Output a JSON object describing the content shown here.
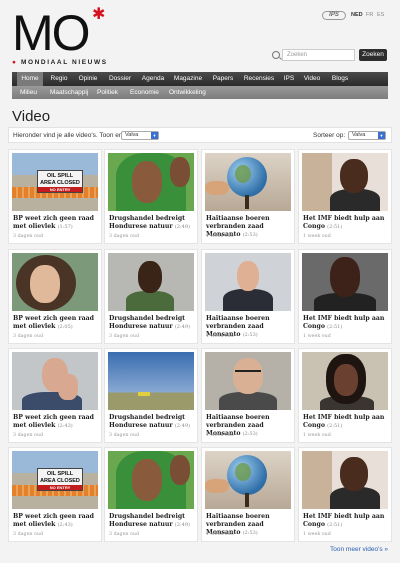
{
  "site": {
    "logo": "MO",
    "tagline": "MONDIAAL NIEUWS",
    "partner_badge": "IPS",
    "languages": [
      "NED",
      "FR",
      "ES"
    ]
  },
  "search": {
    "placeholder": "Zoeken",
    "button": "Zoeken"
  },
  "nav": {
    "primary": [
      "Home",
      "Regio",
      "Opinie",
      "Dossier",
      "Agenda",
      "Magazine",
      "Papers",
      "Recensies",
      "IPS",
      "Video",
      "Blogs"
    ],
    "active": "Home",
    "secondary": [
      "Milieu",
      "Maatschappij",
      "Politiek",
      "Economie",
      "Ontwikkeling"
    ]
  },
  "page": {
    "title": "Video",
    "filter_label": "Hieronder vind je alle video's. Toon enkel:",
    "filter_value": "Valva",
    "sort_label": "Sorteer op:",
    "sort_value": "Valva",
    "more_link": "Toon meer video's »"
  },
  "videos": [
    {
      "title": "BP weet zich geen raad met olievlek",
      "duration": "(1:57)",
      "date": "3 dagen oud",
      "thumb": "oil-spill"
    },
    {
      "title": "Drugshandel bedreigt Hondurese natuur",
      "duration": "(2:49)",
      "date": "3 dagen oud",
      "thumb": "girl-green-scarf"
    },
    {
      "title": "Haïtiaanse boeren verbranden zaad Monsanto",
      "duration": "(2:53)",
      "date": "1 week oud",
      "thumb": "globe"
    },
    {
      "title": "Het IMF biedt hulp aan Congo",
      "duration": "(2:51)",
      "date": "1 week oud",
      "thumb": "woman"
    },
    {
      "title": "BP weet zich geen raad met olievlek",
      "duration": "(2:05)",
      "date": "3 dagen oud",
      "thumb": "curly-hair"
    },
    {
      "title": "Drugshandel bedreigt Hondurese natuur",
      "duration": "(2:49)",
      "date": "3 dagen oud",
      "thumb": "man-green-shirt"
    },
    {
      "title": "Haïtiaanse boeren verbranden zaad Monsanto",
      "duration": "(2:53)",
      "date": "1 week oud",
      "thumb": "man-suit"
    },
    {
      "title": "Het IMF biedt hulp aan Congo",
      "duration": "(2:51)",
      "date": "1 week oud",
      "thumb": "man-dark"
    },
    {
      "title": "BP weet zich geen raad met olievlek",
      "duration": "(2:43)",
      "date": "3 dagen oud",
      "thumb": "man-hand-face"
    },
    {
      "title": "Drugshandel bedreigt Hondurese natuur",
      "duration": "(2:49)",
      "date": "3 dagen oud",
      "thumb": "sky"
    },
    {
      "title": "Haïtiaanse boeren verbranden zaad Monsanto",
      "duration": "(2:53)",
      "date": "1 week oud",
      "thumb": "man-glasses"
    },
    {
      "title": "Het IMF biedt hulp aan Congo",
      "duration": "(2:51)",
      "date": "1 week oud",
      "thumb": "woman-2"
    },
    {
      "title": "BP weet zich geen raad met olievlek",
      "duration": "(2:43)",
      "date": "3 dagen oud",
      "thumb": "oil-spill"
    },
    {
      "title": "Drugshandel bedreigt Hondurese natuur",
      "duration": "(2:49)",
      "date": "3 dagen oud",
      "thumb": "girl-green-scarf"
    },
    {
      "title": "Haïtiaanse boeren verbranden zaad Monsanto",
      "duration": "(2:53)",
      "date": "1 week oud",
      "thumb": "globe"
    },
    {
      "title": "Het IMF biedt hulp aan Congo",
      "duration": "(2:51)",
      "date": "1 week oud",
      "thumb": "woman"
    }
  ],
  "thumb_text": {
    "oil_sign_1": "OIL SPILL",
    "oil_sign_2": "AREA CLOSED",
    "oil_sign_3": "NO ENTRY"
  },
  "colors": {
    "accent": "#d4131e",
    "nav_dark": "#2b2b2b",
    "link": "#2a5db0"
  }
}
